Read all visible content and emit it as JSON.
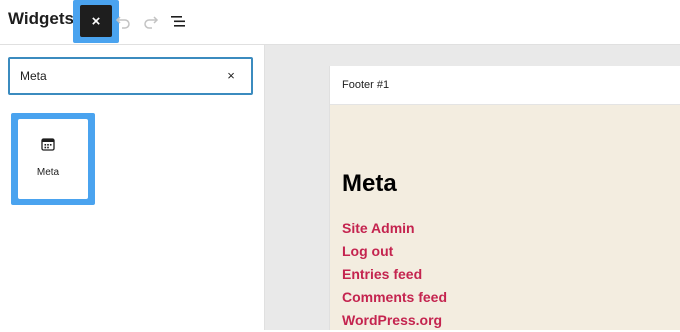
{
  "header": {
    "title": "Widgets",
    "close_label": "×"
  },
  "search": {
    "value": "Meta",
    "clear_label": "×"
  },
  "inserter": {
    "blocks": [
      {
        "label": "Meta",
        "icon": "calendar-icon"
      }
    ]
  },
  "canvas": {
    "area_title": "Footer #1",
    "widget_heading": "Meta",
    "links": [
      "Site Admin",
      "Log out",
      "Entries feed",
      "Comments feed",
      "WordPress.org"
    ],
    "link_color": "#c4244f",
    "background_color": "#f3ede0"
  }
}
